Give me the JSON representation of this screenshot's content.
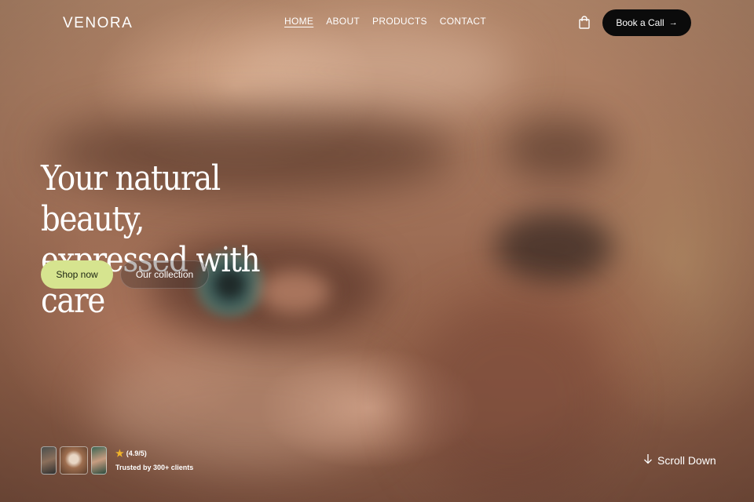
{
  "brand": {
    "logo": "VENORA"
  },
  "nav": {
    "items": [
      {
        "label": "HOME",
        "active": true
      },
      {
        "label": "ABOUT",
        "active": false
      },
      {
        "label": "PRODUCTS",
        "active": false
      },
      {
        "label": "CONTACT",
        "active": false
      }
    ],
    "cart_icon": "shopping-bag-icon",
    "cta_label": "Book a Call",
    "cta_icon": "arrow-right-icon"
  },
  "hero": {
    "headline_line1": "Your natural beauty,",
    "headline_line2": "expressed with care",
    "primary_button": "Shop now",
    "secondary_button": "Our collection"
  },
  "trust": {
    "rating_icon": "star-icon",
    "rating_text": "(4.9/5)",
    "trusted_text": "Trusted by 300+ clients"
  },
  "scroll": {
    "label": "Scroll Down",
    "icon": "arrow-down-icon"
  },
  "colors": {
    "accent": "#d6e48f",
    "cta_bg": "#0b0b0b",
    "star": "#f2b52a"
  }
}
